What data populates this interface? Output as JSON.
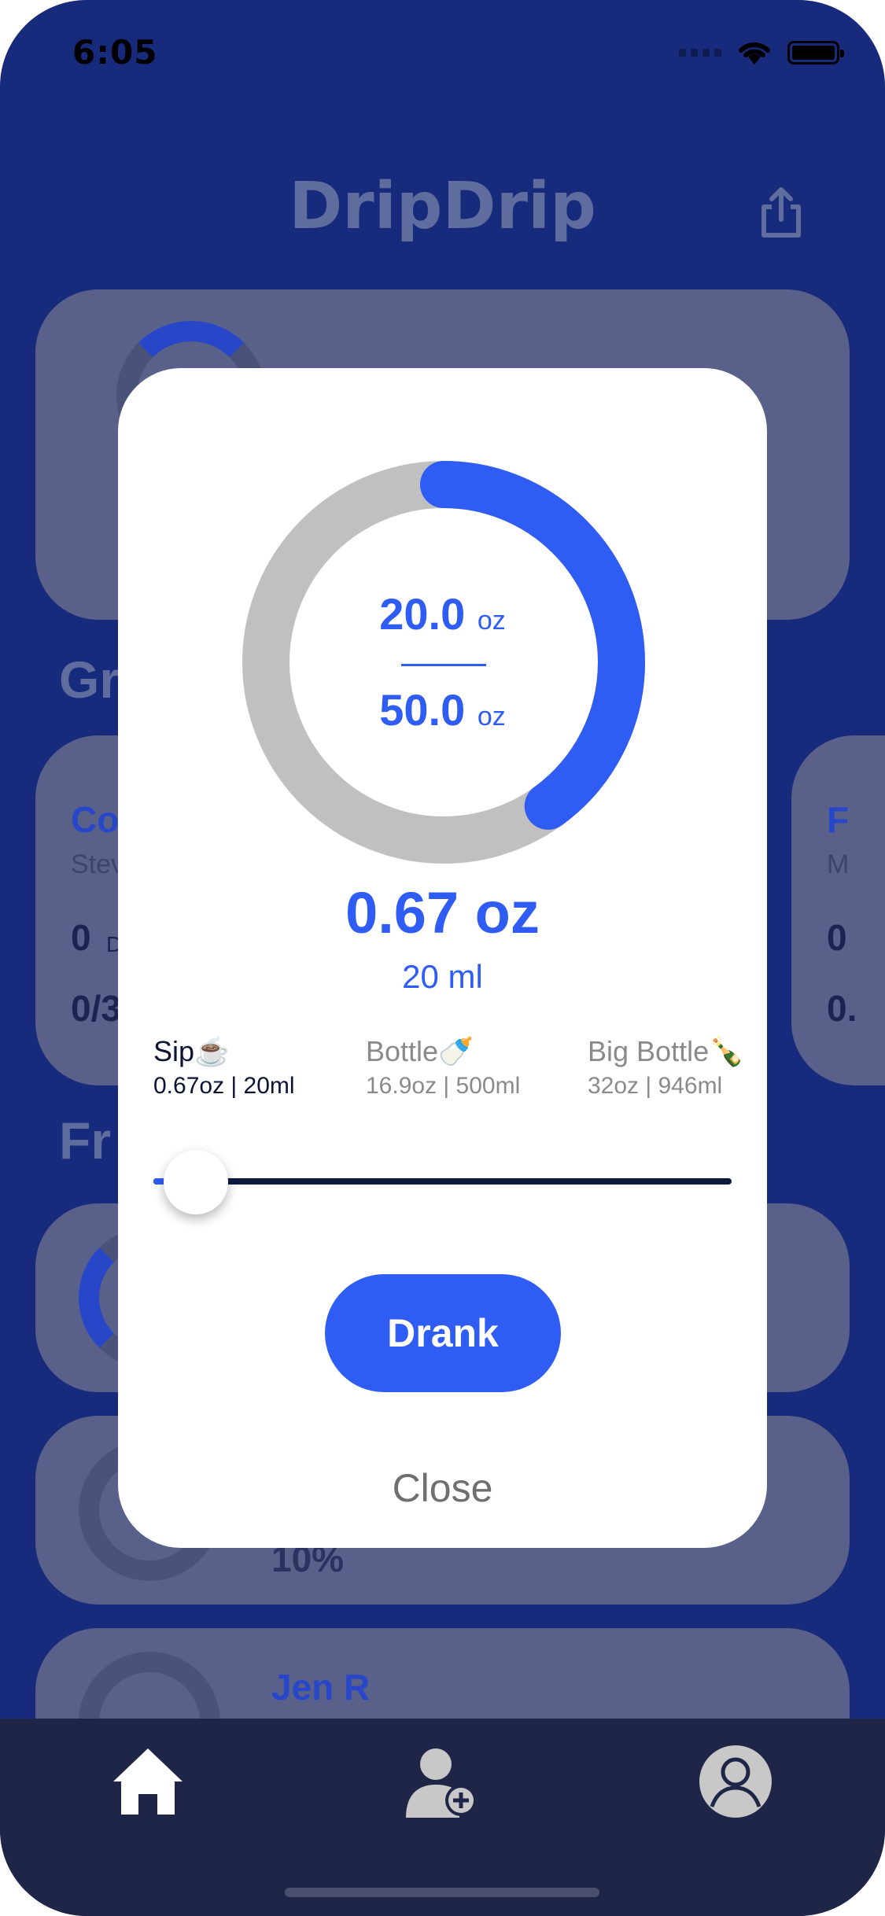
{
  "status_bar": {
    "time": "6:05"
  },
  "header": {
    "title": "DripDrip",
    "share_icon": "share-icon"
  },
  "background": {
    "groups_heading": "Gr",
    "group_card_left": {
      "title": "Co",
      "subtitle": "Stev",
      "count": "0",
      "count_suffix": "D",
      "ratio": "0/3"
    },
    "group_card_right": {
      "title": "F",
      "subtitle": "M",
      "count": "0",
      "ratio": "0."
    },
    "friends_heading": "Fr",
    "friend_percent": "10%",
    "friend_name": "Jen R"
  },
  "modal": {
    "progress": {
      "current": "20.0",
      "goal": "50.0",
      "unit": "oz",
      "fraction": 0.4
    },
    "selected_amount": "0.67 oz",
    "selected_amount_ml": "20 ml",
    "options": [
      {
        "label": "Sip☕️",
        "sub": "0.67oz | 20ml",
        "active": true
      },
      {
        "label": "Bottle🍼",
        "sub": "16.9oz | 500ml",
        "active": false
      },
      {
        "label": "Big Bottle🍾",
        "sub": "32oz | 946ml",
        "active": false
      }
    ],
    "slider_value": 0.0,
    "drank_label": "Drank",
    "close_label": "Close"
  },
  "tab_bar": {
    "items": [
      "home-icon",
      "add-friend-icon",
      "profile-icon"
    ],
    "active": "home-icon"
  },
  "colors": {
    "accent": "#2f5cf3",
    "background": "#172a7c",
    "ring_track": "#c0c0c0",
    "tab_bar": "#1f2546"
  }
}
